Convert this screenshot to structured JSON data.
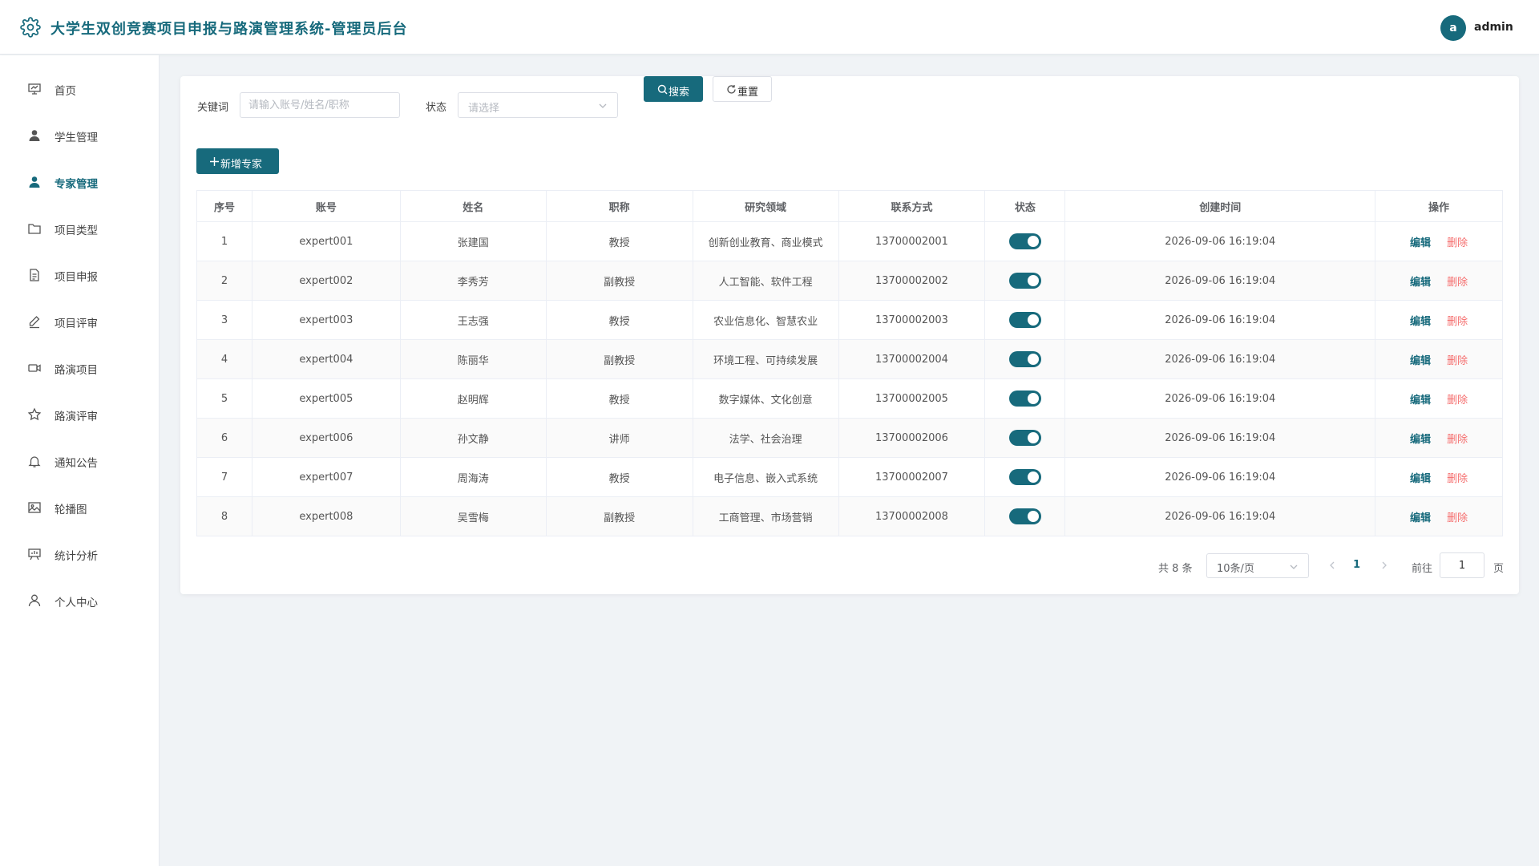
{
  "header": {
    "title": "大学生双创竞赛项目申报与路演管理系统-管理员后台",
    "avatar_letter": "a",
    "username": "admin"
  },
  "sidebar": {
    "items": [
      {
        "label": "首页",
        "icon": "presentation-icon"
      },
      {
        "label": "学生管理",
        "icon": "user-icon"
      },
      {
        "label": "专家管理",
        "icon": "user-icon",
        "active": true
      },
      {
        "label": "项目类型",
        "icon": "folder-icon"
      },
      {
        "label": "项目申报",
        "icon": "document-icon"
      },
      {
        "label": "项目评审",
        "icon": "edit-pen-icon"
      },
      {
        "label": "路演项目",
        "icon": "video-camera-icon"
      },
      {
        "label": "路演评审",
        "icon": "star-icon"
      },
      {
        "label": "通知公告",
        "icon": "bell-icon"
      },
      {
        "label": "轮播图",
        "icon": "picture-icon"
      },
      {
        "label": "统计分析",
        "icon": "chart-board-icon"
      },
      {
        "label": "个人中心",
        "icon": "user-outline-icon"
      }
    ]
  },
  "filters": {
    "keyword_label": "关键词",
    "keyword_placeholder": "请输入账号/姓名/职称",
    "keyword_value": "",
    "status_label": "状态",
    "status_placeholder": "请选择",
    "search_label": "搜索",
    "reset_label": "重置"
  },
  "toolbar": {
    "add_label": "新增专家"
  },
  "table": {
    "columns": [
      "序号",
      "账号",
      "姓名",
      "职称",
      "研究领域",
      "联系方式",
      "状态",
      "创建时间",
      "操作"
    ],
    "edit_label": "编辑",
    "delete_label": "删除",
    "rows": [
      {
        "no": "1",
        "account": "expert001",
        "name": "张建国",
        "title": "教授",
        "field": "创新创业教育、商业模式",
        "phone": "13700002001",
        "enabled": true,
        "created": "2026-09-06 16:19:04"
      },
      {
        "no": "2",
        "account": "expert002",
        "name": "李秀芳",
        "title": "副教授",
        "field": "人工智能、软件工程",
        "phone": "13700002002",
        "enabled": true,
        "created": "2026-09-06 16:19:04"
      },
      {
        "no": "3",
        "account": "expert003",
        "name": "王志强",
        "title": "教授",
        "field": "农业信息化、智慧农业",
        "phone": "13700002003",
        "enabled": true,
        "created": "2026-09-06 16:19:04"
      },
      {
        "no": "4",
        "account": "expert004",
        "name": "陈丽华",
        "title": "副教授",
        "field": "环境工程、可持续发展",
        "phone": "13700002004",
        "enabled": true,
        "created": "2026-09-06 16:19:04"
      },
      {
        "no": "5",
        "account": "expert005",
        "name": "赵明辉",
        "title": "教授",
        "field": "数字媒体、文化创意",
        "phone": "13700002005",
        "enabled": true,
        "created": "2026-09-06 16:19:04"
      },
      {
        "no": "6",
        "account": "expert006",
        "name": "孙文静",
        "title": "讲师",
        "field": "法学、社会治理",
        "phone": "13700002006",
        "enabled": true,
        "created": "2026-09-06 16:19:04"
      },
      {
        "no": "7",
        "account": "expert007",
        "name": "周海涛",
        "title": "教授",
        "field": "电子信息、嵌入式系统",
        "phone": "13700002007",
        "enabled": true,
        "created": "2026-09-06 16:19:04"
      },
      {
        "no": "8",
        "account": "expert008",
        "name": "吴雪梅",
        "title": "副教授",
        "field": "工商管理、市场营销",
        "phone": "13700002008",
        "enabled": true,
        "created": "2026-09-06 16:19:04"
      }
    ]
  },
  "pagination": {
    "total_text": "共 8 条",
    "page_size": "10条/页",
    "current_page": "1",
    "goto_label": "前往",
    "goto_value": "1",
    "page_unit": "页"
  },
  "colors": {
    "primary": "#176a7c",
    "danger": "#f56c6c",
    "background": "#f0f3f6"
  }
}
